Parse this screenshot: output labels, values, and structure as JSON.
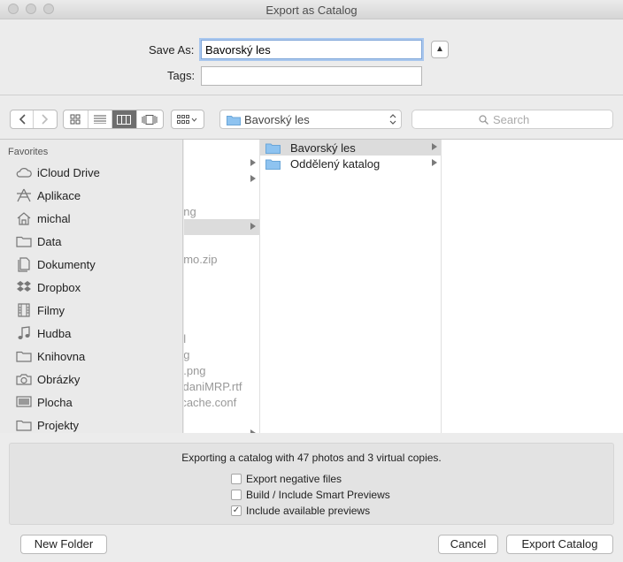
{
  "window": {
    "title": "Export as Catalog"
  },
  "form": {
    "save_as_label": "Save As:",
    "save_as_value": "Bavorský les",
    "tags_label": "Tags:",
    "tags_value": ""
  },
  "toolbar": {
    "path_popup": "Bavorský les",
    "search_placeholder": "Search"
  },
  "sidebar": {
    "heading": "Favorites",
    "items": [
      {
        "label": "iCloud Drive",
        "icon": "cloud-icon"
      },
      {
        "label": "Aplikace",
        "icon": "applications-icon"
      },
      {
        "label": "michal",
        "icon": "home-icon"
      },
      {
        "label": "Data",
        "icon": "folder-icon"
      },
      {
        "label": "Dokumenty",
        "icon": "documents-icon"
      },
      {
        "label": "Dropbox",
        "icon": "dropbox-icon"
      },
      {
        "label": "Filmy",
        "icon": "film-icon"
      },
      {
        "label": "Hudba",
        "icon": "music-icon"
      },
      {
        "label": "Knihovna",
        "icon": "folder-icon"
      },
      {
        "label": "Obrázky",
        "icon": "camera-icon"
      },
      {
        "label": "Plocha",
        "icon": "desktop-icon"
      },
      {
        "label": "Projekty",
        "icon": "folder-icon"
      }
    ]
  },
  "browser": {
    "prev_column_fragments": [
      "ong",
      "emo.zip",
      "al",
      "ng",
      "a.png",
      "ydaniMRP.rtf",
      "-cache.conf"
    ],
    "current_column": [
      {
        "name": "Bavorský les",
        "selected": true
      },
      {
        "name": "Oddělený katalog",
        "selected": false
      }
    ]
  },
  "options": {
    "message": "Exporting a catalog with 47 photos and 3 virtual copies.",
    "checkboxes": [
      {
        "label": "Export negative files",
        "checked": false
      },
      {
        "label": "Build / Include Smart Previews",
        "checked": false
      },
      {
        "label": "Include available previews",
        "checked": true
      }
    ]
  },
  "buttons": {
    "new_folder": "New Folder",
    "cancel": "Cancel",
    "export": "Export Catalog"
  },
  "colors": {
    "folder": "#8ec3f0",
    "selection": "#dcdcdc"
  }
}
